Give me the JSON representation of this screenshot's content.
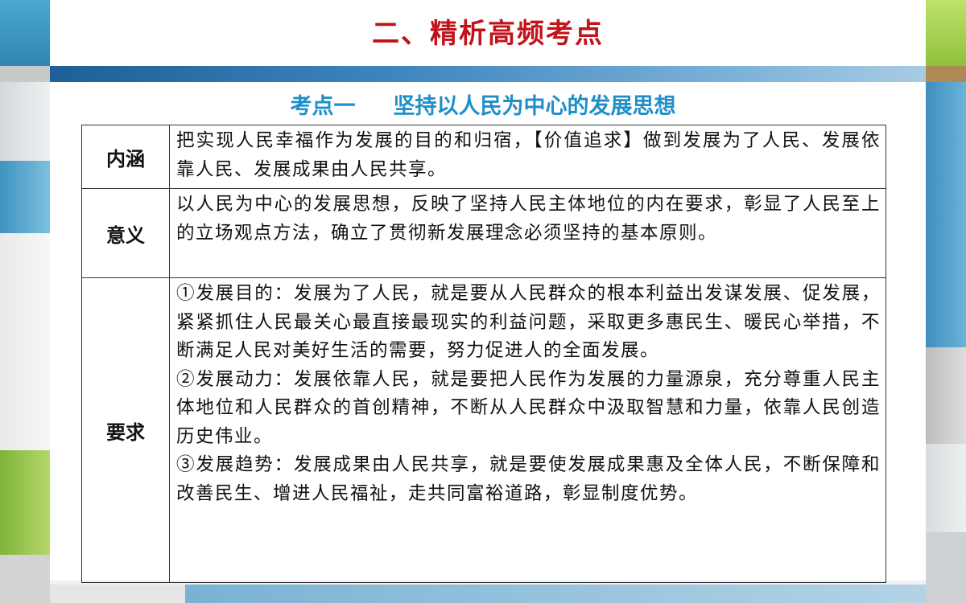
{
  "slide": {
    "title": "二、精析高频考点",
    "subtitle": "考点一     坚持以人民为中心的发展思想"
  },
  "table": {
    "rows": [
      {
        "header": "内涵",
        "content": "把实现人民幸福作为发展的目的和归宿，【价值追求】做到发展为了人民、发展依靠人民、发展成果由人民共享。"
      },
      {
        "header": "意义",
        "content": "以人民为中心的发展思想，反映了坚持人民主体地位的内在要求，彰显了人民至上的立场观点方法，确立了贯彻新发展理念必须坚持的基本原则。"
      },
      {
        "header": "要求",
        "paragraphs": [
          "①发展目的：发展为了人民，就是要从人民群众的根本利益出发谋发展、促发展，紧紧抓住人民最关心最直接最现实的利益问题，采取更多惠民生、暖民心举措，不断满足人民对美好生活的需要，努力促进人的全面发展。",
          "②发展动力：发展依靠人民，就是要把人民作为发展的力量源泉，充分尊重人民主体地位和人民群众的首创精神，不断从人民群众中汲取智慧和力量，依靠人民创造历史伟业。",
          "③发展趋势：发展成果由人民共享，就是要使发展成果惠及全体人民，不断保障和改善民生、增进人民福祉，走共同富裕道路，彰显制度优势。"
        ]
      }
    ]
  },
  "colors": {
    "title": "#c0141a",
    "subtitle": "#1f8fc9",
    "accent_bar": "#2f74ad"
  }
}
